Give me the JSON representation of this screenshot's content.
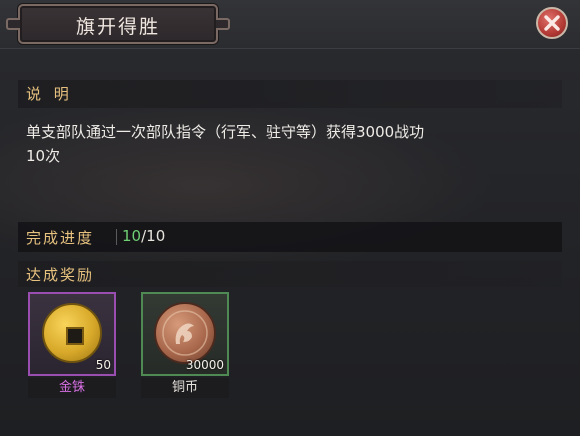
{
  "window": {
    "title": "旗开得胜"
  },
  "description": {
    "label": "说  明",
    "text_line1": "单支部队通过一次部队指令（行军、驻守等）获得3000战功",
    "text_line2": "10次"
  },
  "progress": {
    "label": "完成进度",
    "current": "10",
    "total": "/10"
  },
  "rewards": {
    "label": "达成奖励",
    "items": [
      {
        "name": "金铢",
        "count": "50",
        "icon": "gold-coin-icon",
        "quality_color": "#9a4fb0"
      },
      {
        "name": "铜币",
        "count": "30000",
        "icon": "copper-coin-icon",
        "quality_color": "#4f8a55"
      }
    ]
  },
  "colors": {
    "label_gold": "#e7c27f",
    "progress_green": "#6fcf74",
    "close_red": "#b33a35"
  }
}
